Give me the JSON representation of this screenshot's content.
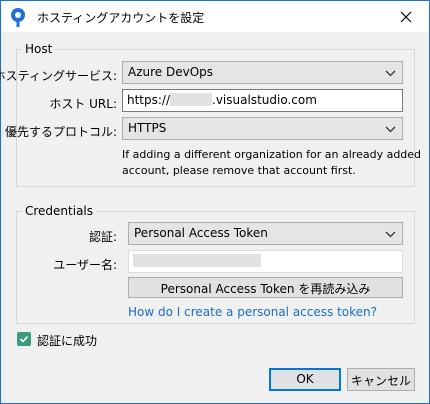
{
  "window": {
    "title": "ホスティングアカウントを設定"
  },
  "host": {
    "legend": "Host",
    "service_label": "ホスティングサービス:",
    "service_value": "Azure DevOps",
    "url_label": "ホスト URL:",
    "url_prefix": "https://",
    "url_suffix": ".visualstudio.com",
    "protocol_label": "優先するプロトコル:",
    "protocol_value": "HTTPS",
    "note_line1": "If adding a different organization for an already added",
    "note_line2": "account, please remove that account first."
  },
  "credentials": {
    "legend": "Credentials",
    "auth_label": "認証:",
    "auth_value": "Personal Access Token",
    "username_label": "ユーザー名:",
    "reload_button": "Personal Access Token を再読み込み",
    "help_link": "How do I create a personal access token?"
  },
  "auth_success": {
    "label": "認証に成功",
    "checked": true
  },
  "buttons": {
    "ok": "OK",
    "cancel": "キャンセル"
  },
  "colors": {
    "accent": "#0078d7",
    "link": "#1a6fbf",
    "check": "#3a9b79",
    "app_icon": "#1f6fd6"
  },
  "icons": {
    "app": "sourcetree-icon",
    "close": "close-icon",
    "dropdown": "chevron-down-icon",
    "check": "checkmark-icon"
  }
}
